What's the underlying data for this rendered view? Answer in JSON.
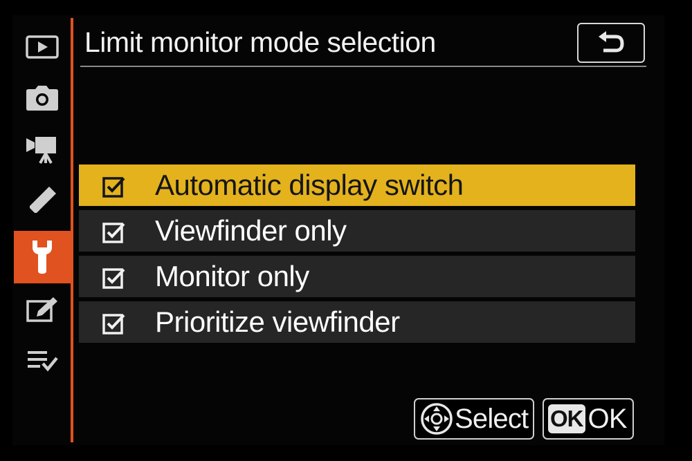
{
  "header": {
    "title": "Limit monitor mode selection",
    "back_icon": "back-arrow-icon"
  },
  "sidebar": {
    "items": [
      {
        "icon": "playback-icon",
        "active": false
      },
      {
        "icon": "camera-icon",
        "active": false
      },
      {
        "icon": "movie-camera-icon",
        "active": false
      },
      {
        "icon": "pencil-icon",
        "active": false
      },
      {
        "icon": "wrench-icon",
        "active": true
      },
      {
        "icon": "retouch-icon",
        "active": false
      },
      {
        "icon": "my-menu-icon",
        "active": false
      }
    ]
  },
  "options": [
    {
      "label": "Automatic display switch",
      "checked": true,
      "selected": true
    },
    {
      "label": "Viewfinder only",
      "checked": true,
      "selected": false
    },
    {
      "label": "Monitor only",
      "checked": true,
      "selected": false
    },
    {
      "label": "Prioritize viewfinder",
      "checked": true,
      "selected": false
    }
  ],
  "footer": {
    "select_label": "Select",
    "ok_chip": "OK",
    "ok_label": "OK"
  },
  "colors": {
    "accent": "#e0521f",
    "highlight": "#e3b21d",
    "row_bg": "#262626"
  }
}
